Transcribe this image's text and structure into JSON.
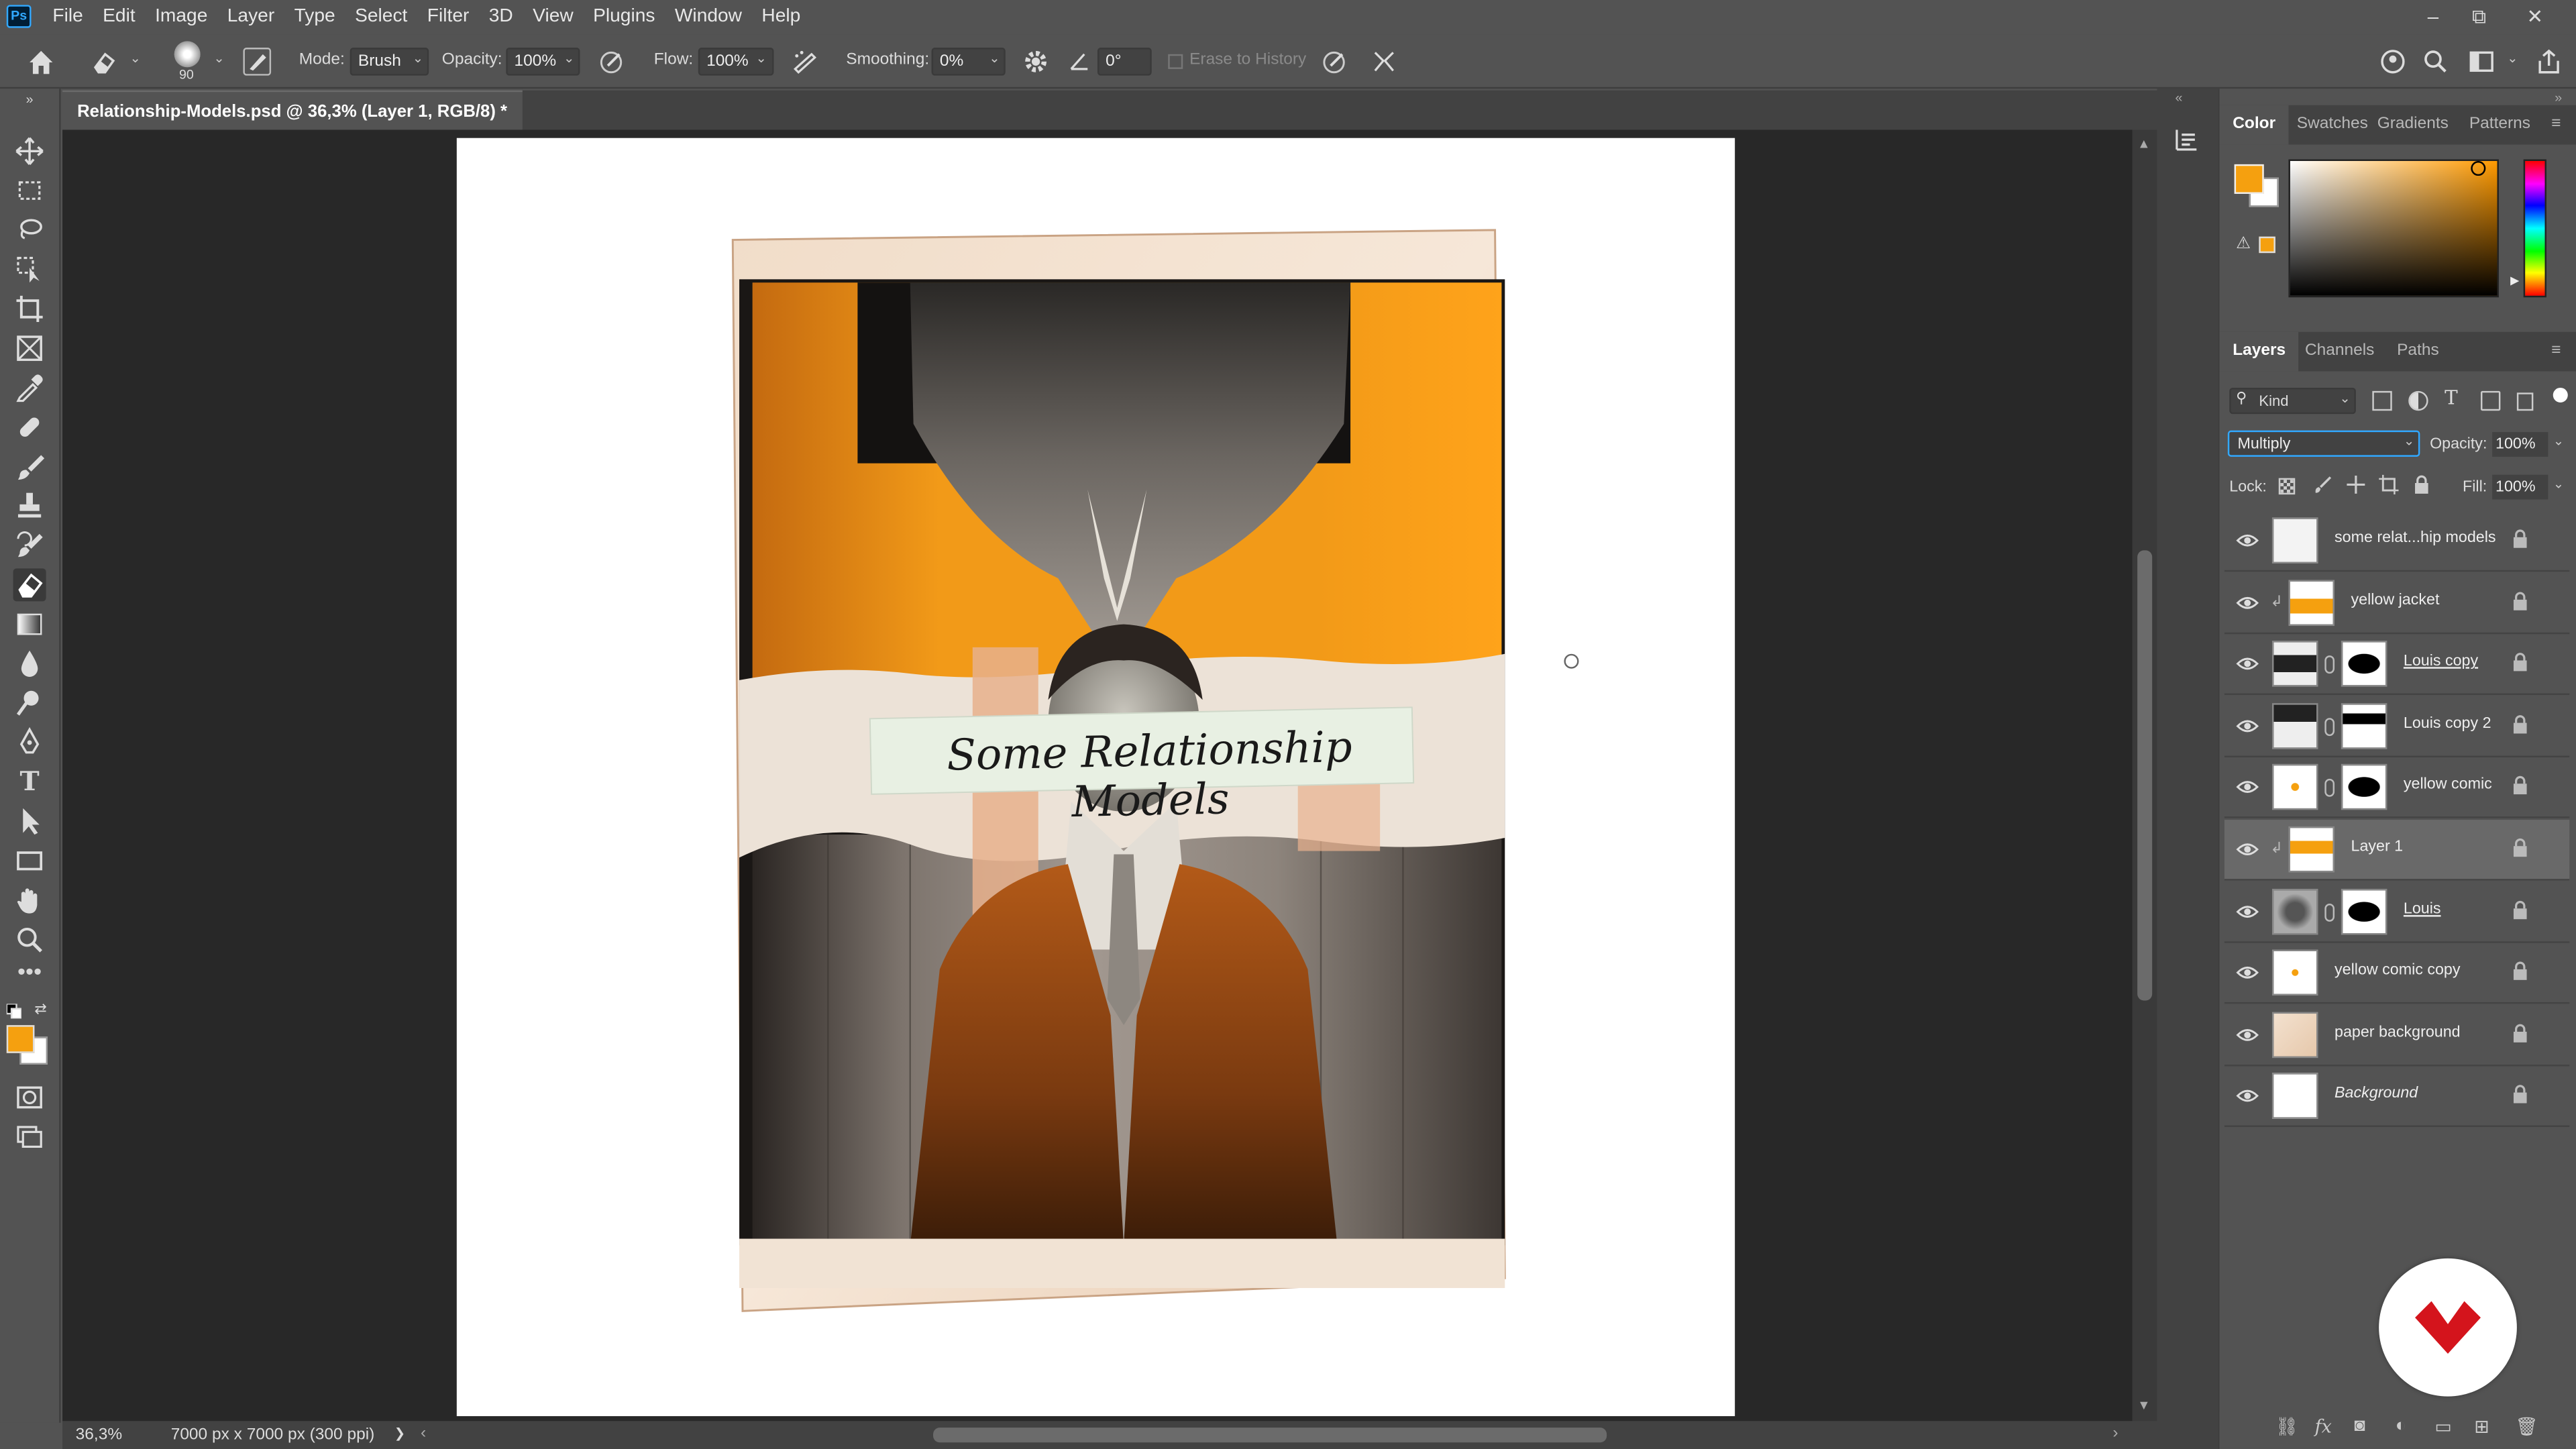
{
  "app": {
    "logo_text": "Ps"
  },
  "menu": [
    "File",
    "Edit",
    "Image",
    "Layer",
    "Type",
    "Select",
    "Filter",
    "3D",
    "View",
    "Plugins",
    "Window",
    "Help"
  ],
  "window_controls": {
    "minimize": "–",
    "restore": "⧉",
    "close": "✕"
  },
  "options": {
    "brush_size": "90",
    "mode_label": "Mode:",
    "mode_value": "Brush",
    "opacity_label": "Opacity:",
    "opacity_value": "100%",
    "flow_label": "Flow:",
    "flow_value": "100%",
    "smoothing_label": "Smoothing:",
    "smoothing_value": "0%",
    "angle_value": "0°",
    "erase_history_label": "Erase to History"
  },
  "document": {
    "tab_title": "Relationship-Models.psd @ 36,3% (Layer 1, RGB/8) *",
    "close_glyph": "×",
    "artwork_title": "Some Relationship Models"
  },
  "status": {
    "zoom": "36,3%",
    "dimensions": "7000 px x 7000 px (300 ppi)",
    "arrow": "❯"
  },
  "color_panel": {
    "tabs": [
      "Color",
      "Swatches",
      "Gradients",
      "Patterns"
    ],
    "foreground": "#f5a00f",
    "background": "#ffffff"
  },
  "layers_panel": {
    "tabs": [
      "Layers",
      "Channels",
      "Paths"
    ],
    "filter_label": "Kind",
    "blend_mode": "Multiply",
    "opacity_label": "Opacity:",
    "opacity_value": "100%",
    "lock_label": "Lock:",
    "fill_label": "Fill:",
    "fill_value": "100%",
    "layers": [
      {
        "name": "some relat...hip models",
        "mask": false,
        "clip": false,
        "selected": false
      },
      {
        "name": "yellow jacket",
        "mask": false,
        "clip": true,
        "selected": false
      },
      {
        "name": "Louis copy",
        "mask": true,
        "clip": false,
        "selected": false
      },
      {
        "name": "Louis copy 2",
        "mask": true,
        "clip": false,
        "selected": false
      },
      {
        "name": "yellow comic",
        "mask": true,
        "clip": false,
        "selected": false
      },
      {
        "name": "Layer 1",
        "mask": false,
        "clip": true,
        "selected": true
      },
      {
        "name": "Louis",
        "mask": true,
        "clip": false,
        "selected": false
      },
      {
        "name": "yellow comic copy",
        "mask": false,
        "clip": false,
        "selected": false
      },
      {
        "name": "paper background",
        "mask": false,
        "clip": false,
        "selected": false
      },
      {
        "name": "Background",
        "mask": false,
        "clip": false,
        "selected": false
      }
    ]
  },
  "bottom_icons": [
    "link-icon",
    "fx-icon",
    "mask-icon",
    "adjustment-icon",
    "folder-icon",
    "new-layer-icon",
    "trash-icon"
  ]
}
